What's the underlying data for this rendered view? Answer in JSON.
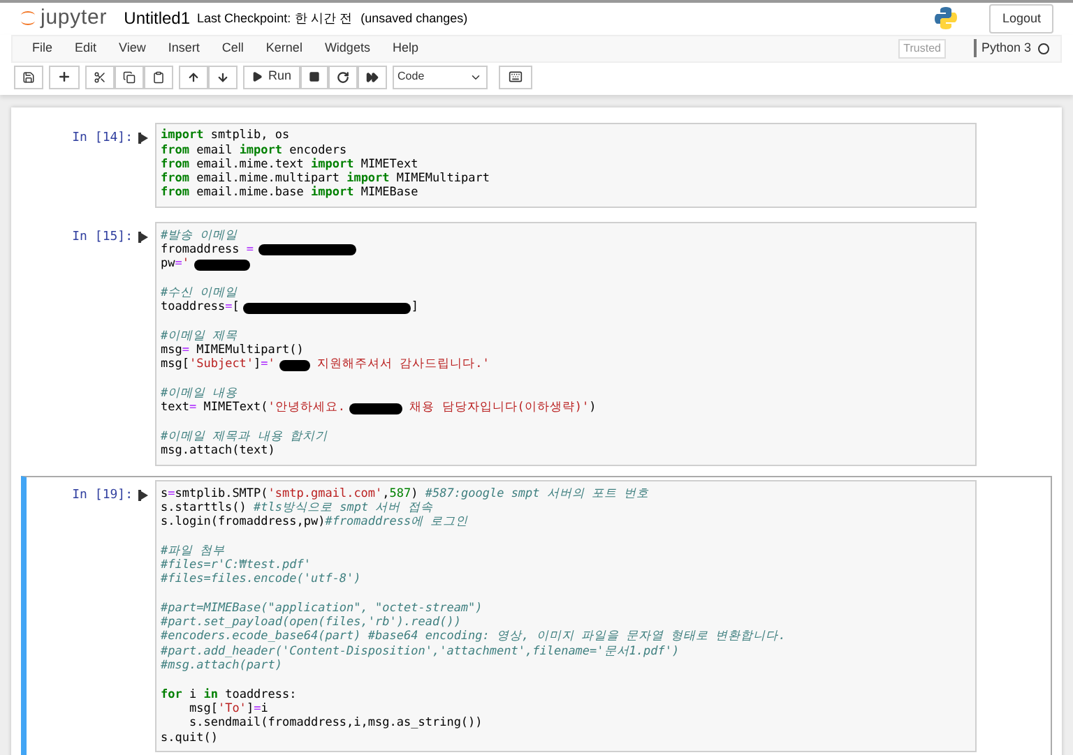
{
  "header": {
    "logo_text": "jupyter",
    "notebook_name": "Untitled1",
    "checkpoint_label": "Last Checkpoint:",
    "checkpoint_time": "한 시간 전",
    "status": "(unsaved changes)",
    "logout": "Logout"
  },
  "menu": [
    "File",
    "Edit",
    "View",
    "Insert",
    "Cell",
    "Kernel",
    "Widgets",
    "Help"
  ],
  "trusted": "Trusted",
  "kernel": {
    "name": "Python 3",
    "busy": false
  },
  "toolbar": {
    "run_label": "Run",
    "cell_type": "Code"
  },
  "cells": [
    {
      "prompt": "In [14]:",
      "selected": false,
      "lines": [
        {
          "kind": "code",
          "tokens": [
            {
              "kind": "kw",
              "text": "import"
            },
            {
              "kind": "plain",
              "text": " smtplib, os"
            }
          ]
        },
        {
          "kind": "code",
          "tokens": [
            {
              "kind": "kw",
              "text": "from"
            },
            {
              "kind": "plain",
              "text": " email "
            },
            {
              "kind": "kw",
              "text": "import"
            },
            {
              "kind": "plain",
              "text": " encoders"
            }
          ]
        },
        {
          "kind": "code",
          "tokens": [
            {
              "kind": "kw",
              "text": "from"
            },
            {
              "kind": "plain",
              "text": " email.mime.text "
            },
            {
              "kind": "kw",
              "text": "import"
            },
            {
              "kind": "plain",
              "text": " MIMEText"
            }
          ]
        },
        {
          "kind": "code",
          "tokens": [
            {
              "kind": "kw",
              "text": "from"
            },
            {
              "kind": "plain",
              "text": " email.mime.multipart "
            },
            {
              "kind": "kw",
              "text": "import"
            },
            {
              "kind": "plain",
              "text": " MIMEMultipart"
            }
          ]
        },
        {
          "kind": "code",
          "tokens": [
            {
              "kind": "kw",
              "text": "from"
            },
            {
              "kind": "plain",
              "text": " email.mime.base "
            },
            {
              "kind": "kw",
              "text": "import"
            },
            {
              "kind": "plain",
              "text": " MIMEBase"
            }
          ]
        }
      ]
    },
    {
      "prompt": "In [15]:",
      "selected": false,
      "lines": [
        {
          "kind": "code",
          "tokens": [
            {
              "kind": "comment",
              "text": "#발송 이메일"
            }
          ]
        },
        {
          "kind": "code",
          "tokens": [
            {
              "kind": "plain",
              "text": "fromaddress "
            },
            {
              "kind": "op",
              "text": "="
            },
            {
              "kind": "redacted"
            }
          ]
        },
        {
          "kind": "code",
          "tokens": [
            {
              "kind": "plain",
              "text": "pw"
            },
            {
              "kind": "op",
              "text": "="
            },
            {
              "kind": "str",
              "text": "'"
            },
            {
              "kind": "redacted"
            }
          ]
        },
        {
          "kind": "blank"
        },
        {
          "kind": "code",
          "tokens": [
            {
              "kind": "comment",
              "text": "#수신 이메일"
            }
          ]
        },
        {
          "kind": "code",
          "tokens": [
            {
              "kind": "plain",
              "text": "toaddress"
            },
            {
              "kind": "op",
              "text": "="
            },
            {
              "kind": "plain",
              "text": "["
            },
            {
              "kind": "redacted"
            },
            {
              "kind": "plain",
              "text": "]"
            }
          ]
        },
        {
          "kind": "blank"
        },
        {
          "kind": "code",
          "tokens": [
            {
              "kind": "comment",
              "text": "#이메일 제목"
            }
          ]
        },
        {
          "kind": "code",
          "tokens": [
            {
              "kind": "plain",
              "text": "msg"
            },
            {
              "kind": "op",
              "text": "="
            },
            {
              "kind": "plain",
              "text": " MIMEMultipart()"
            }
          ]
        },
        {
          "kind": "code",
          "tokens": [
            {
              "kind": "plain",
              "text": "msg["
            },
            {
              "kind": "str",
              "text": "'Subject'"
            },
            {
              "kind": "plain",
              "text": "]"
            },
            {
              "kind": "op",
              "text": "="
            },
            {
              "kind": "str",
              "text": "'"
            },
            {
              "kind": "redacted"
            },
            {
              "kind": "str",
              "text": " 지원해주셔서 감사드립니다.'"
            }
          ]
        },
        {
          "kind": "blank"
        },
        {
          "kind": "code",
          "tokens": [
            {
              "kind": "comment",
              "text": "#이메일 내용"
            }
          ]
        },
        {
          "kind": "code",
          "tokens": [
            {
              "kind": "plain",
              "text": "text"
            },
            {
              "kind": "op",
              "text": "="
            },
            {
              "kind": "plain",
              "text": " MIMEText("
            },
            {
              "kind": "str",
              "text": "'안녕하세요."
            },
            {
              "kind": "redacted"
            },
            {
              "kind": "str",
              "text": " 채용 담당자입니다(이하생략)'"
            },
            {
              "kind": "plain",
              "text": ")"
            }
          ]
        },
        {
          "kind": "blank"
        },
        {
          "kind": "code",
          "tokens": [
            {
              "kind": "comment",
              "text": "#이메일 제목과 내용 합치기"
            }
          ]
        },
        {
          "kind": "code",
          "tokens": [
            {
              "kind": "plain",
              "text": "msg.attach(text)"
            }
          ]
        }
      ]
    },
    {
      "prompt": "In [19]:",
      "selected": true,
      "lines": [
        {
          "kind": "code",
          "tokens": [
            {
              "kind": "plain",
              "text": "s"
            },
            {
              "kind": "op",
              "text": "="
            },
            {
              "kind": "plain",
              "text": "smtplib.SMTP("
            },
            {
              "kind": "str",
              "text": "'smtp.gmail.com'"
            },
            {
              "kind": "plain",
              "text": ","
            },
            {
              "kind": "num",
              "text": "587"
            },
            {
              "kind": "plain",
              "text": ") "
            },
            {
              "kind": "comment",
              "text": "#587:google smpt 서버의 포트 번호"
            }
          ]
        },
        {
          "kind": "code",
          "tokens": [
            {
              "kind": "plain",
              "text": "s.starttls() "
            },
            {
              "kind": "comment",
              "text": "#tls방식으로 smpt 서버 접속"
            }
          ]
        },
        {
          "kind": "code",
          "tokens": [
            {
              "kind": "plain",
              "text": "s.login(fromaddress,pw)"
            },
            {
              "kind": "comment",
              "text": "#fromaddress에 로그인"
            }
          ]
        },
        {
          "kind": "blank"
        },
        {
          "kind": "code",
          "tokens": [
            {
              "kind": "comment",
              "text": "#파일 첨부"
            }
          ]
        },
        {
          "kind": "code",
          "tokens": [
            {
              "kind": "comment",
              "text": "#files=r'C:₩test.pdf'"
            }
          ]
        },
        {
          "kind": "code",
          "tokens": [
            {
              "kind": "comment",
              "text": "#files=files.encode('utf-8')"
            }
          ]
        },
        {
          "kind": "blank"
        },
        {
          "kind": "code",
          "tokens": [
            {
              "kind": "comment",
              "text": "#part=MIMEBase(\"application\", \"octet-stream\")"
            }
          ]
        },
        {
          "kind": "code",
          "tokens": [
            {
              "kind": "comment",
              "text": "#part.set_payload(open(files,'rb').read())"
            }
          ]
        },
        {
          "kind": "code",
          "tokens": [
            {
              "kind": "comment",
              "text": "#encoders.ecode_base64(part) #base64 encoding: 영상, 이미지 파일을 문자열 형태로 변환합니다."
            }
          ]
        },
        {
          "kind": "code",
          "tokens": [
            {
              "kind": "comment",
              "text": "#part.add_header('Content-Disposition','attachment',filename='문서1.pdf')"
            }
          ]
        },
        {
          "kind": "code",
          "tokens": [
            {
              "kind": "comment",
              "text": "#msg.attach(part)"
            }
          ]
        },
        {
          "kind": "blank"
        },
        {
          "kind": "code",
          "tokens": [
            {
              "kind": "kw",
              "text": "for"
            },
            {
              "kind": "plain",
              "text": " i "
            },
            {
              "kind": "kw",
              "text": "in"
            },
            {
              "kind": "plain",
              "text": " toaddress:"
            }
          ]
        },
        {
          "kind": "code",
          "tokens": [
            {
              "kind": "plain",
              "text": "    msg["
            },
            {
              "kind": "str",
              "text": "'To'"
            },
            {
              "kind": "plain",
              "text": "]"
            },
            {
              "kind": "op",
              "text": "="
            },
            {
              "kind": "plain",
              "text": "i"
            }
          ]
        },
        {
          "kind": "code",
          "tokens": [
            {
              "kind": "plain",
              "text": "    s.sendmail(fromaddress,i,msg.as_string())"
            }
          ]
        },
        {
          "kind": "code",
          "tokens": [
            {
              "kind": "plain",
              "text": "s.quit()"
            }
          ]
        }
      ]
    }
  ]
}
